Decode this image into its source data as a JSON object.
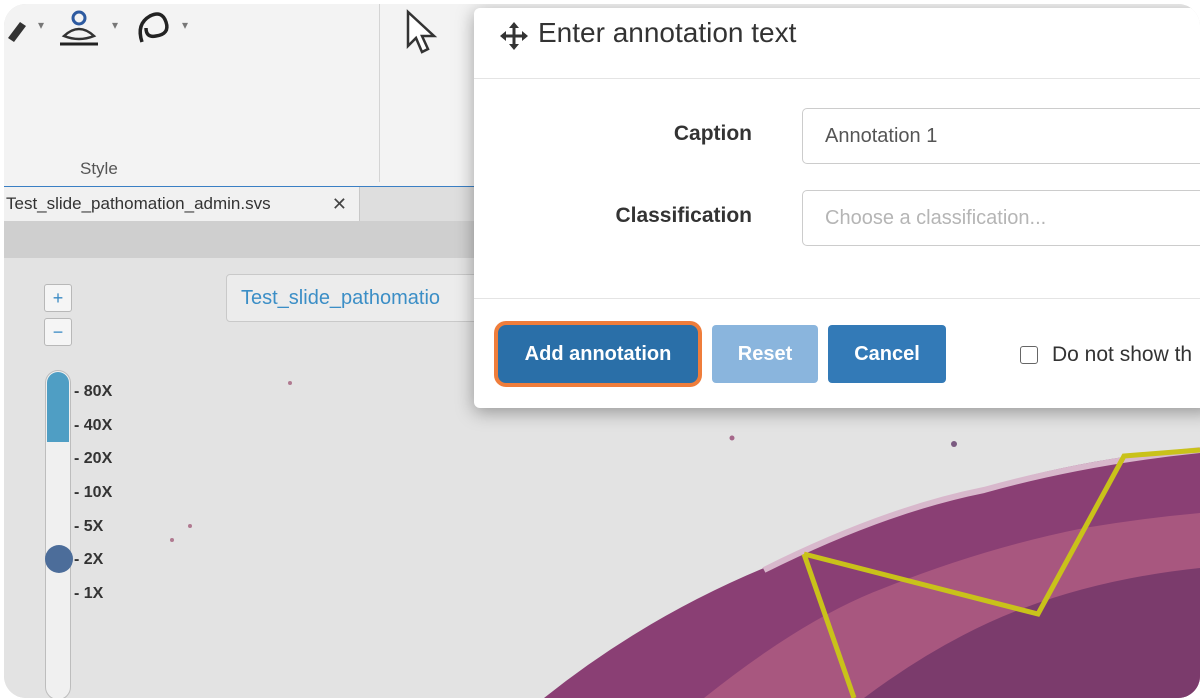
{
  "ribbon": {
    "group_label": "Style",
    "icons": [
      "pen-tool-icon",
      "paw-stamp-icon",
      "lasso-icon",
      "pointer-icon"
    ]
  },
  "tabbar": {
    "tab_label": "Test_slide_pathomation_admin.svs",
    "close_glyph": "✕"
  },
  "viewer": {
    "slide_title": "Test_slide_pathomatio",
    "zoom_in_label": "+",
    "zoom_out_label": "−",
    "zoom_levels": [
      "- 80X",
      "- 40X",
      "- 20X",
      "- 10X",
      "- 5X",
      "- 2X",
      "- 1X"
    ],
    "current_zoom_level": "2X"
  },
  "dialog": {
    "title": "Enter annotation text",
    "caption_label": "Caption",
    "caption_value": "Annotation 1",
    "classification_label": "Classification",
    "classification_placeholder": "Choose a classification...",
    "add_button": "Add annotation",
    "reset_button": "Reset",
    "cancel_button": "Cancel",
    "dont_show_label": "Do not show th",
    "dont_show_checked": false
  },
  "colors": {
    "primary_button": "#2a6fa8",
    "focus_ring": "#ef7d3b",
    "disabled_button": "#8ab5dd",
    "cancel_button": "#337ab7",
    "annotation_outline": "#c9c21a",
    "tissue": "#8a3f74"
  }
}
